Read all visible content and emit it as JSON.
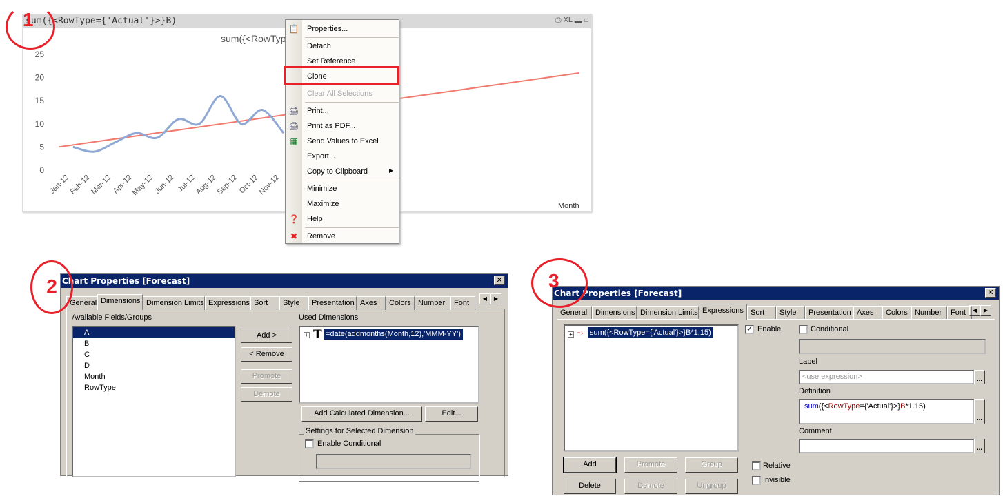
{
  "panel1": {
    "caption_title": "sum({<RowType={'Actual'}>}B)",
    "caption_icons": [
      "print-icon",
      "xl-icon",
      "minimize-icon",
      "maximize-icon"
    ],
    "caption_xl": "XL",
    "chart_title": "sum({<RowType={'Actual'}>}B)",
    "x_axis_label": "Month",
    "context_menu": [
      {
        "label": "Properties...",
        "icon": "properties-icon"
      },
      {
        "label": "Detach"
      },
      {
        "label": "Set Reference"
      },
      {
        "label": "Clone",
        "highlighted": true
      },
      {
        "label": "Clear All Selections",
        "disabled": true
      },
      {
        "label": "Print...",
        "icon": "printer-icon"
      },
      {
        "label": "Print as PDF...",
        "icon": "pdf-printer-icon"
      },
      {
        "label": "Send Values to Excel",
        "icon": "excel-icon"
      },
      {
        "label": "Export..."
      },
      {
        "label": "Copy to Clipboard",
        "submenu": true
      },
      {
        "label": "Minimize"
      },
      {
        "label": "Maximize"
      },
      {
        "label": "Help",
        "icon": "help-icon"
      },
      {
        "label": "Remove",
        "icon": "remove-icon"
      }
    ]
  },
  "chart_data": {
    "type": "line",
    "categories": [
      "Jan-12",
      "Feb-12",
      "Mar-12",
      "Apr-12",
      "May-12",
      "Jun-12",
      "Jul-12",
      "Aug-12",
      "Sep-12",
      "Oct-12",
      "Nov-12"
    ],
    "yticks": [
      "0",
      "5",
      "10",
      "15",
      "20",
      "25"
    ],
    "ylim": [
      0,
      25
    ],
    "xlabel": "Month",
    "grid": false,
    "series": [
      {
        "values": [
          5,
          4,
          6,
          8,
          7,
          11,
          10,
          16,
          10,
          13,
          8
        ],
        "color": "#8fa8d4",
        "smooth": true
      },
      {
        "trend_start": 5,
        "trend_end": 21,
        "color": "#f07a6e"
      }
    ]
  },
  "panel2": {
    "number": "2",
    "title": "Chart Properties [Forecast]",
    "tabs": [
      "General",
      "Dimensions",
      "Dimension Limits",
      "Expressions",
      "Sort",
      "Style",
      "Presentation",
      "Axes",
      "Colors",
      "Number",
      "Font"
    ],
    "active_tab": "Dimensions",
    "available_label": "Available Fields/Groups",
    "fields": [
      "A",
      "B",
      "C",
      "D",
      "Month",
      "RowType"
    ],
    "selected_field": "A",
    "add": "Add >",
    "remove": "< Remove",
    "promote": "Promote",
    "demote": "Demote",
    "used_label": "Used Dimensions",
    "used_dimension": "=date(addmonths(Month,12),'MMM-YY')",
    "add_calc": "Add Calculated Dimension...",
    "edit": "Edit...",
    "settings_group": "Settings for Selected Dimension",
    "enable_conditional": "Enable Conditional"
  },
  "panel3": {
    "number": "3",
    "title": "Chart Properties [Forecast]",
    "tabs": [
      "General",
      "Dimensions",
      "Dimension Limits",
      "Expressions",
      "Sort",
      "Style",
      "Presentation",
      "Axes",
      "Colors",
      "Number",
      "Font"
    ],
    "active_tab": "Expressions",
    "expression": "sum({<RowType={'Actual'}>}B*1.15)",
    "enable": "Enable",
    "conditional": "Conditional",
    "label": "Label",
    "label_placeholder": "<use expression>",
    "definition": "Definition",
    "def_parts": [
      "sum",
      "({<",
      "RowType",
      "={'Actual'}>}",
      "B",
      "*1.15)"
    ],
    "comment": "Comment",
    "add": "Add",
    "promote": "Promote",
    "group": "Group",
    "delete": "Delete",
    "demote": "Demote",
    "ungroup": "Ungroup",
    "relative": "Relative",
    "invisible": "Invisible",
    "dots": "..."
  },
  "panel1_number": "1",
  "annotation_color": "#e8202a"
}
